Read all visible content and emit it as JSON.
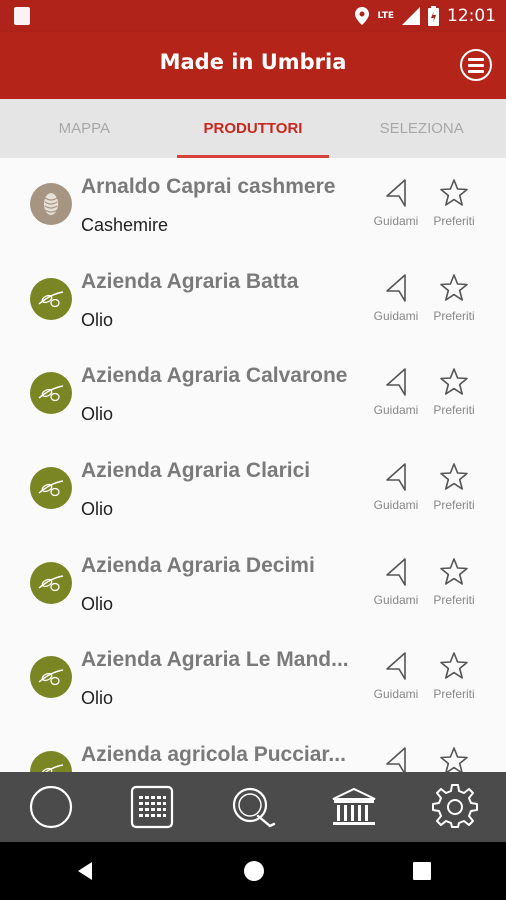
{
  "status_bar": {
    "network": "LTE",
    "time": "12:01"
  },
  "app_bar": {
    "title": "Made in Umbria",
    "menu_icon": "menu-icon"
  },
  "tabs": [
    {
      "label": "MAPPA",
      "active": false
    },
    {
      "label": "PRODUTTORI",
      "active": true
    },
    {
      "label": "SELEZIONA",
      "active": false
    }
  ],
  "producers": [
    {
      "name": "Arnaldo Caprai cashmere",
      "category": "Cashemire",
      "icon": "cashmere-icon"
    },
    {
      "name": "Azienda Agraria Batta",
      "category": "Olio",
      "icon": "olive-icon"
    },
    {
      "name": "Azienda Agraria Calvarone",
      "category": "Olio",
      "icon": "olive-icon"
    },
    {
      "name": "Azienda Agraria Clarici",
      "category": "Olio",
      "icon": "olive-icon"
    },
    {
      "name": "Azienda Agraria Decimi",
      "category": "Olio",
      "icon": "olive-icon"
    },
    {
      "name": "Azienda Agraria Le Mand...",
      "category": "Olio",
      "icon": "olive-icon"
    },
    {
      "name": "Azienda agricola Pucciar...",
      "category": "",
      "icon": "olive-icon"
    }
  ],
  "actions": {
    "guidami_label": "Guidami",
    "preferiti_label": "Preferiti"
  },
  "bottom_nav": [
    "circle-icon",
    "calendar-grid-icon",
    "search-q-icon",
    "museum-icon",
    "settings-gear-icon"
  ],
  "colors": {
    "primary": "#b52419",
    "accent": "#c62820",
    "olive": "#7a8624",
    "nav_bg": "#4b4b4b"
  }
}
